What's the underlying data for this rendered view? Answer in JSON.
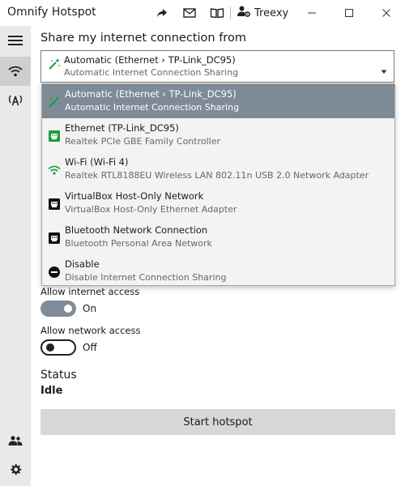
{
  "window": {
    "title": "Omnify Hotspot",
    "user_name": "Treexy"
  },
  "main": {
    "section_title": "Share my internet connection from",
    "combo": {
      "title": "Automatic (Ethernet › TP-Link_DC95)",
      "subtitle": "Automatic Internet Connection Sharing"
    },
    "allow_internet_label": "Allow internet access",
    "allow_internet_state": "On",
    "allow_network_label": "Allow network access",
    "allow_network_state": "Off",
    "status_title": "Status",
    "status_value": "Idle",
    "start_button": "Start hotspot"
  },
  "dropdown": {
    "items": [
      {
        "title": "Automatic (Ethernet › TP-Link_DC95)",
        "subtitle": "Automatic Internet Connection Sharing",
        "icon": "magic-wand-icon",
        "selected": true
      },
      {
        "title": "Ethernet (TP-Link_DC95)",
        "subtitle": "Realtek PCIe GBE Family Controller",
        "icon": "ethernet-icon"
      },
      {
        "title": "Wi-Fi (Wi-Fi 4)",
        "subtitle": "Realtek RTL8188EU Wireless LAN 802.11n USB 2.0 Network Adapter",
        "icon": "wifi-icon"
      },
      {
        "title": "VirtualBox Host-Only Network",
        "subtitle": "VirtualBox Host-Only Ethernet Adapter",
        "icon": "network-adapter-icon"
      },
      {
        "title": "Bluetooth Network Connection",
        "subtitle": "Bluetooth Personal Area Network",
        "icon": "network-adapter-icon"
      },
      {
        "title": "Disable",
        "subtitle": "Disable Internet Connection Sharing",
        "icon": "disable-icon"
      }
    ]
  },
  "colors": {
    "accent": "#7e8b96",
    "connected_green": "#1b9e3e",
    "sidebar_bg": "#e9e9e9"
  }
}
